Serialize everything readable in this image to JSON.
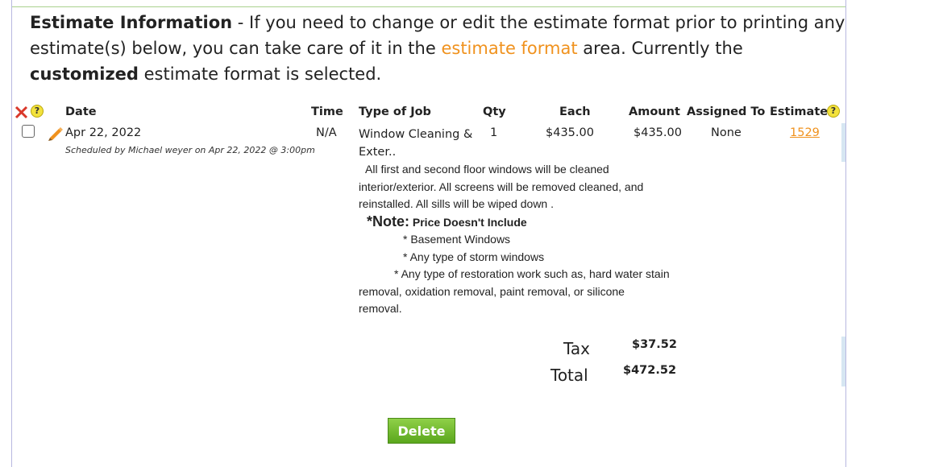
{
  "info": {
    "title": "Estimate Information",
    "text_part1": " - If you need to change or edit the estimate format prior to printing any estimate(s) below, you can take care of it in the ",
    "link": "estimate format",
    "text_part2": " area. Currently the ",
    "bold_word": "customized",
    "text_part3": " estimate format is selected."
  },
  "table": {
    "headers": {
      "date": "Date",
      "time": "Time",
      "type_of_job": "Type of Job",
      "qty": "Qty",
      "each": "Each",
      "amount": "Amount",
      "assigned_to": "Assigned To",
      "estimate": "Estimate"
    },
    "row": {
      "date": "Apr 22, 2022",
      "scheduled": "Scheduled by Michael weyer on Apr 22, 2022 @ 3:00pm",
      "time": "N/A",
      "job_title_line1": "Window Cleaning &",
      "job_title_line2": "Exter..",
      "qty": "1",
      "each": "$435.00",
      "amount": "$435.00",
      "assigned_to": "None",
      "estimate_number": "1529"
    },
    "description": {
      "line1": "All first and second floor windows will be cleaned",
      "line2": "interior/exterior. All screens will be removed cleaned, and",
      "line3": "reinstalled. All sills will be wiped down .",
      "note_prefix": "*Note:",
      "note_text": " Price Doesn't Include",
      "bullet1": "* Basement Windows",
      "bullet2": "* Any type of storm windows",
      "bullet3": "* Any type of restoration work such as, hard water stain",
      "line4": "removal, oxidation removal, paint removal, or silicone",
      "line5": "removal."
    }
  },
  "totals": {
    "tax_label": "Tax",
    "tax_value": "$37.52",
    "total_label": "Total",
    "total_value": "$472.52"
  },
  "actions": {
    "delete_label": "Delete"
  },
  "icons": {
    "delete_all": "red-x-icon",
    "help": "help-icon",
    "edit": "pencil-icon",
    "help_glyph": "?"
  },
  "colors": {
    "link": "#f0921e",
    "button_green": "#6dbb2a",
    "help_yellow": "#f3e23c",
    "x_red": "#d9382a",
    "pencil_orange": "#f0921e"
  }
}
